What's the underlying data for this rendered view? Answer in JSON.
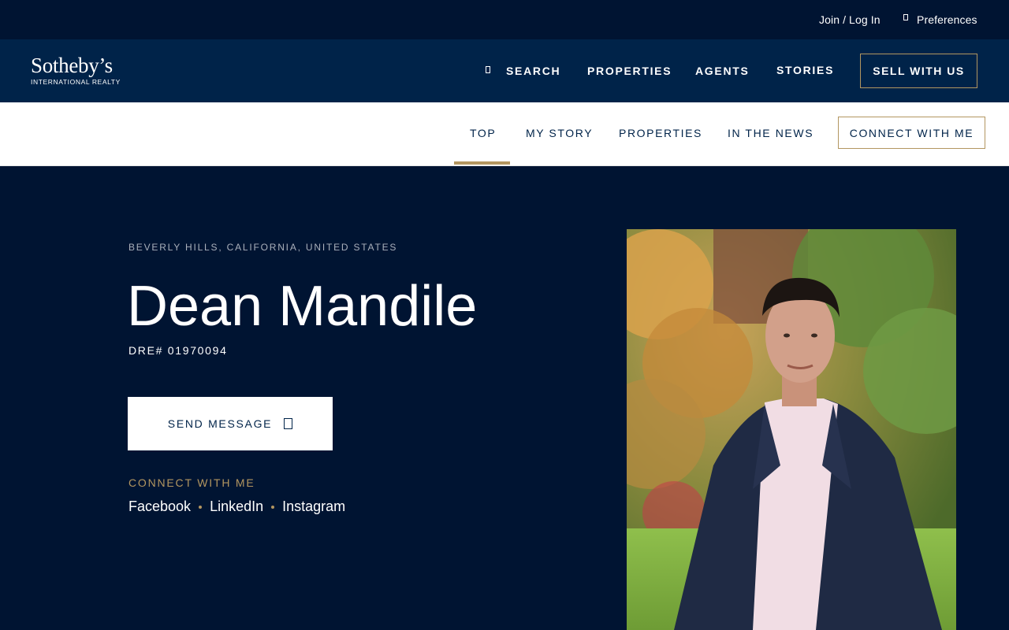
{
  "utility": {
    "login_label": "Join / Log In",
    "preferences_label": "Preferences"
  },
  "brand": {
    "name": "Sotheby’s",
    "subtitle": "INTERNATIONAL REALTY"
  },
  "main_nav": {
    "search_label": "SEARCH",
    "properties_label": "PROPERTIES",
    "agents_label": "AGENTS",
    "stories_label": "STORIES",
    "sell_label": "SELL WITH US"
  },
  "sub_nav": {
    "items": [
      {
        "label": "TOP",
        "active": true
      },
      {
        "label": "MY STORY"
      },
      {
        "label": "PROPERTIES"
      },
      {
        "label": "IN THE NEWS"
      }
    ],
    "connect_label": "CONNECT WITH ME"
  },
  "agent": {
    "location": "BEVERLY HILLS, CALIFORNIA, UNITED STATES",
    "name": "Dean Mandile",
    "license": "DRE# 01970094",
    "send_message_label": "SEND MESSAGE",
    "connect_heading": "CONNECT WITH ME",
    "social": [
      "Facebook",
      "LinkedIn",
      "Instagram"
    ]
  },
  "colors": {
    "navy_dark": "#001432",
    "navy": "#002349",
    "gold": "#b39660",
    "white": "#ffffff"
  },
  "icons": {
    "preferences": "preferences-icon",
    "search": "search-icon",
    "mail": "mail-icon"
  }
}
